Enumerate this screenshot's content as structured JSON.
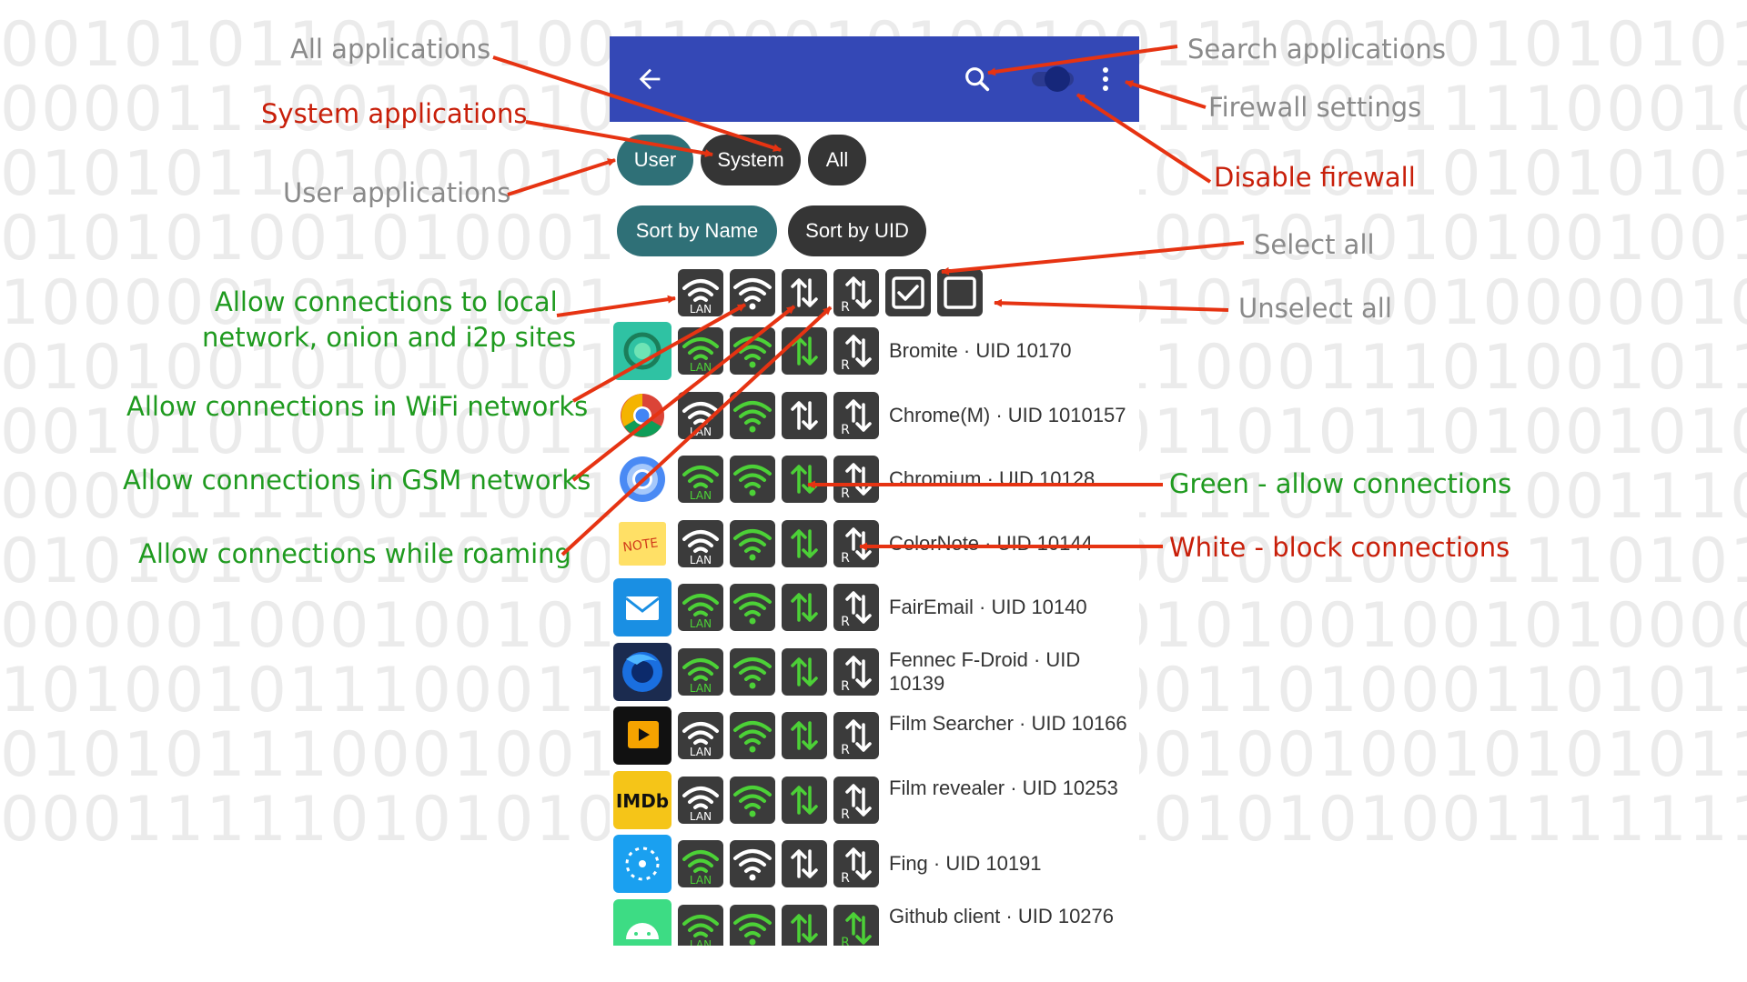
{
  "background_binary": [
    "001010110100100110001010010011100100101010111001",
    "000011100101010110010101000111100011110001010101",
    "010101101001010111010011110101010110101010100101",
    "010101001010001011001011010100101010100100101010",
    "100000101101001010010010001010101001000001000101",
    "010100101010101110010110011110001110100101101011",
    "001010101100011001011101010011010110100101011100",
    "000011110011001011001011000111101000100111011001",
    "010101010100100011101001001001001000111010101001",
    "000001000100101001011100100010100100101000010001",
    "101001011100011001010010010001101000110101101110",
    "010101110001001101010110101001001001010101110010",
    "000111110101010101010100101101010100111111101010"
  ],
  "toolbar": {
    "back_icon": "arrow-left-icon",
    "search_icon": "search-icon",
    "menu_icon": "more-vert-icon",
    "firewall_enabled": true,
    "color": "#3448b6"
  },
  "filters": {
    "user": "User",
    "system": "System",
    "all": "All",
    "selected": "User"
  },
  "sort": {
    "by_name": "Sort by Name",
    "by_uid": "Sort by UID",
    "selected": "Sort by Name"
  },
  "header_row": {
    "lan_label": "LAN",
    "roaming_label": "R",
    "icons": [
      "lan-wifi-icon",
      "wifi-icon",
      "gsm-data-icon",
      "roaming-data-icon",
      "checkbox-checked-icon",
      "checkbox-empty-icon"
    ]
  },
  "colors": {
    "allow": "#4cd137",
    "block": "#ffffff",
    "button_bg": "#3b3b3b",
    "annotation_red": "#c81f0a",
    "annotation_green": "#1f9a1f",
    "annotation_gray": "#8a8a8a"
  },
  "apps": [
    {
      "name": "Bromite · UID 10170",
      "icon": "bromite-icon",
      "icon_bg": "#2fc2a3",
      "lan": true,
      "wifi": true,
      "gsm": true,
      "roaming": false
    },
    {
      "name": "Chrome(M) · UID 1010157",
      "icon": "chrome-icon",
      "icon_bg": "#ffffff",
      "lan": false,
      "wifi": true,
      "gsm": false,
      "roaming": false
    },
    {
      "name": "Chromium · UID 10128",
      "icon": "chromium-icon",
      "icon_bg": "#ffffff",
      "lan": true,
      "wifi": true,
      "gsm": true,
      "roaming": false
    },
    {
      "name": "ColorNote · UID 10144",
      "icon": "colornote-icon",
      "icon_bg": "#ffffff",
      "lan": false,
      "wifi": true,
      "gsm": true,
      "roaming": false
    },
    {
      "name": "FairEmail · UID 10140",
      "icon": "fairemail-icon",
      "icon_bg": "#1a8fe3",
      "lan": true,
      "wifi": true,
      "gsm": true,
      "roaming": false
    },
    {
      "name": "Fennec F-Droid · UID 10139",
      "icon": "fennec-icon",
      "icon_bg": "#1b2b4f",
      "lan": true,
      "wifi": true,
      "gsm": true,
      "roaming": false
    },
    {
      "name": "Film Searcher · UID 10166",
      "icon": "film-searcher-icon",
      "icon_bg": "#111111",
      "lan": false,
      "wifi": true,
      "gsm": true,
      "roaming": false
    },
    {
      "name": "Film revealer · UID 10253",
      "icon": "imdb-icon",
      "icon_bg": "#f5c518",
      "lan": false,
      "wifi": true,
      "gsm": true,
      "roaming": false
    },
    {
      "name": "Fing · UID 10191",
      "icon": "fing-icon",
      "icon_bg": "#1aa0f0",
      "lan": true,
      "wifi": false,
      "gsm": false,
      "roaming": false
    },
    {
      "name": "Github client · UID 10276",
      "icon": "android-icon",
      "icon_bg": "#3ddc84",
      "lan": true,
      "wifi": true,
      "gsm": true,
      "roaming": true
    }
  ],
  "annotations": {
    "all_applications": "All applications",
    "system_applications": "System applications",
    "user_applications": "User applications",
    "search_applications": "Search applications",
    "firewall_settings": "Firewall settings",
    "disable_firewall": "Disable firewall",
    "select_all": "Select all",
    "unselect_all": "Unselect all",
    "allow_local_1": "Allow connections to local",
    "allow_local_2": "network, onion and i2p sites",
    "allow_wifi": "Allow connections in WiFi networks",
    "allow_gsm": "Allow connections in GSM networks",
    "allow_roaming": "Allow connections while roaming",
    "green_allow": "Green - allow connections",
    "white_block": "White - block connections"
  }
}
